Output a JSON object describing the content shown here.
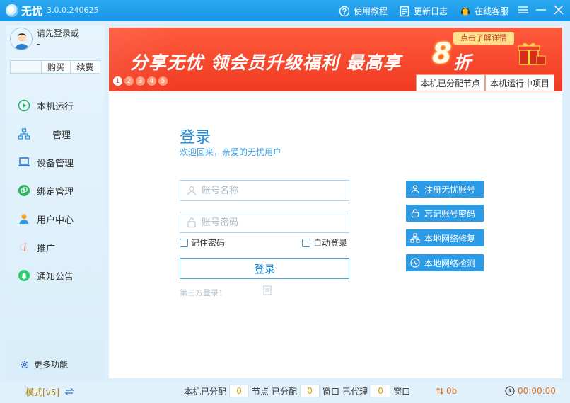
{
  "titlebar": {
    "app_name": "无忧",
    "version": "3.0.0.240625",
    "links": [
      {
        "label": "使用教程",
        "icon": "help-circle-icon"
      },
      {
        "label": "更新日志",
        "icon": "document-icon"
      },
      {
        "label": "在线客服",
        "icon": "headset-icon"
      }
    ]
  },
  "sidebar": {
    "login_hint": "请先登录或",
    "login_hint2": "-",
    "buy_label": "购买",
    "renew_label": "续费",
    "items": [
      {
        "label": "本机运行",
        "icon": "play-circle-icon"
      },
      {
        "label": "管理",
        "icon": "network-tree-icon"
      },
      {
        "label": "设备管理",
        "icon": "laptop-icon"
      },
      {
        "label": "绑定管理",
        "icon": "link-icon"
      },
      {
        "label": "用户中心",
        "icon": "user-icon"
      },
      {
        "label": "推广",
        "icon": "megaphone-icon"
      },
      {
        "label": "通知公告",
        "icon": "bell-icon"
      }
    ],
    "more_label": "更多功能"
  },
  "banner": {
    "slogan": "分享无忧 领会员升级福利 最高享",
    "number": "8",
    "suffix": "折",
    "cta": "点击了解详情",
    "dots": [
      "1",
      "2",
      "3",
      "4",
      "5"
    ],
    "tabs": [
      "本机已分配节点",
      "本机运行中项目"
    ]
  },
  "login": {
    "title": "登录",
    "subtitle": "欢迎回来，亲爱的无忧用户",
    "username_placeholder": "账号名称",
    "password_placeholder": "账号密码",
    "remember_label": "记住密码",
    "auto_label": "自动登录",
    "submit_label": "登录",
    "third_party_label": "第三方登录："
  },
  "actions": [
    {
      "label": "注册无忧账号",
      "icon": "user-icon"
    },
    {
      "label": "忘记账号密码",
      "icon": "lock-icon"
    },
    {
      "label": "本地网络修复",
      "icon": "network-tree-icon"
    },
    {
      "label": "本地网络检测",
      "icon": "pulse-icon"
    }
  ],
  "statusbar": {
    "mode": "模式[v5]",
    "assigned_label": "本机已分配",
    "assigned_value": "0",
    "node_label": "节点",
    "allocated_label": "已分配",
    "allocated_value": "0",
    "window_label": "窗口",
    "proxy_label": "已代理",
    "proxy_value": "0",
    "window_label2": "窗口",
    "traffic": "0b",
    "time": "00:00:00"
  },
  "colors": {
    "accent": "#2b9be8",
    "banner": "#f03a22",
    "warning": "#e07020"
  }
}
